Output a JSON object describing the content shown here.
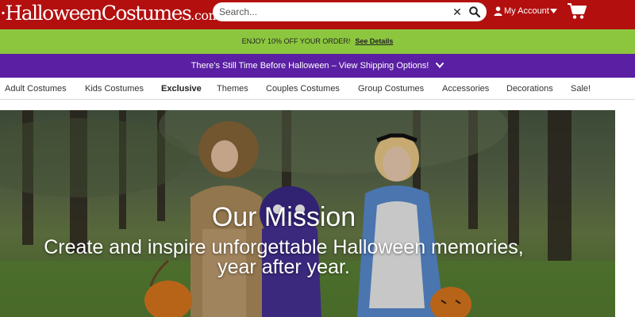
{
  "header": {
    "logo_text": "HalloweenCostumes",
    "logo_suffix": ".com",
    "search_placeholder": "Search...",
    "account_label": "My Account",
    "colors": {
      "background": "#b30f0f"
    },
    "icons": [
      "close-icon",
      "search-icon",
      "user-icon",
      "caret-down-icon",
      "cart-icon"
    ]
  },
  "promo": {
    "text": "ENJOY 10% OFF YOUR ORDER!",
    "link_label": "See Details",
    "color": "#8cc63f"
  },
  "shipping": {
    "text": "There's Still Time Before Halloween – View Shipping Options!",
    "color": "#5a1fa3"
  },
  "nav": {
    "items": [
      "Adult Costumes",
      "Kids Costumes",
      "Exclusive",
      "Themes",
      "Couples Costumes",
      "Group Costumes",
      "Accessories",
      "Decorations",
      "Sale!"
    ]
  },
  "hero": {
    "title": "Our Mission",
    "subtitle_line1": "Create and inspire unforgettable Halloween memories,",
    "subtitle_line2": "year after year."
  }
}
